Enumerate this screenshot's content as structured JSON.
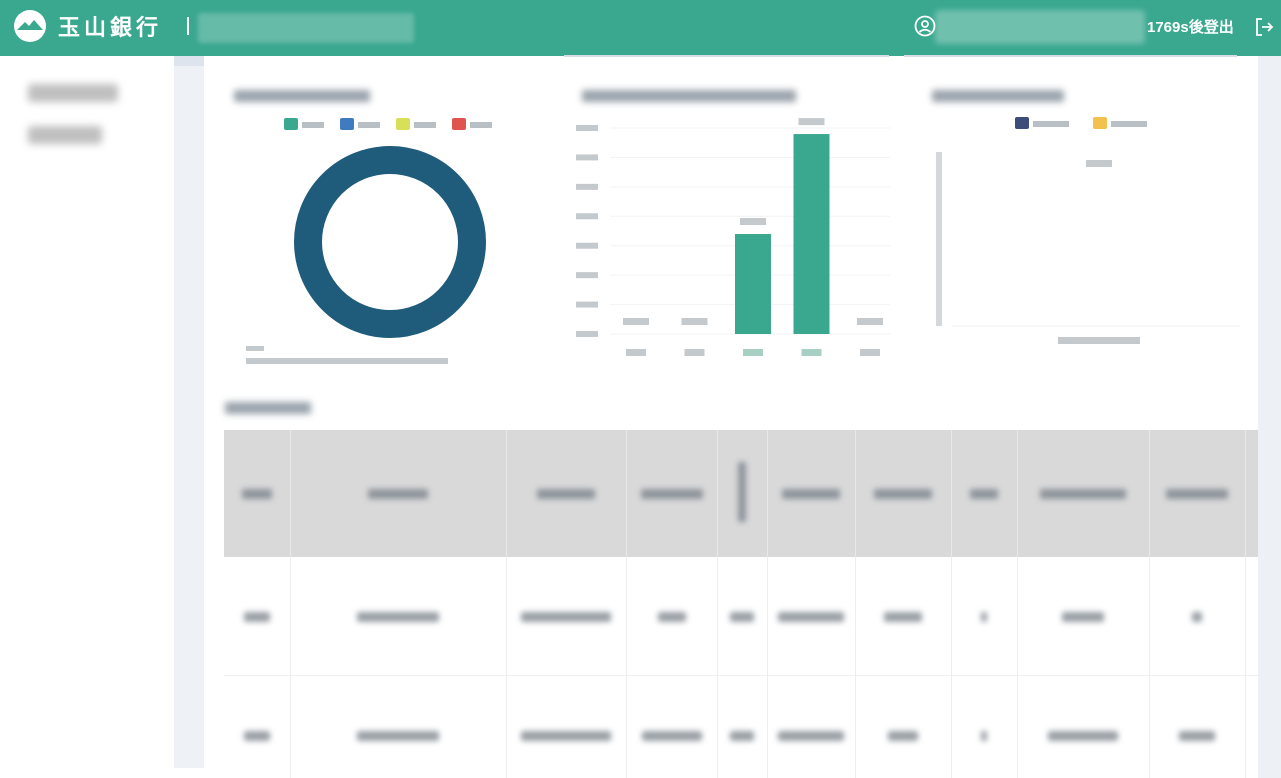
{
  "brand": {
    "name": "玉山銀行"
  },
  "header": {
    "session_timer": "1769s後登出"
  },
  "icons": {
    "logo": "mountain-logo-icon",
    "user": "user-circle-icon",
    "logout": "logout-icon"
  },
  "colors": {
    "header_bg": "#3aa88f",
    "donut": "#1f5b7a",
    "bar": "#3aa88f",
    "legend_green": "#3aa88f",
    "legend_blue": "#3f7cbf",
    "legend_yellow": "#d8e05a",
    "legend_red": "#e0544f",
    "legend_navy": "#3d4d7a",
    "legend_orange": "#f2c14e"
  },
  "chart_data": [
    {
      "type": "pie",
      "values": [
        100
      ],
      "legend_colors": [
        "#3aa88f",
        "#3f7cbf",
        "#d8e05a",
        "#e0544f"
      ]
    },
    {
      "type": "bar",
      "values": [
        0,
        0,
        3.3,
        6.6,
        0
      ],
      "highlight": [
        false,
        false,
        true,
        true,
        false
      ]
    },
    {
      "type": "bar",
      "values": [],
      "legend_colors": [
        "#3d4d7a",
        "#f2c14e"
      ]
    }
  ],
  "table": {
    "column_count": 11,
    "row_count": 2
  }
}
